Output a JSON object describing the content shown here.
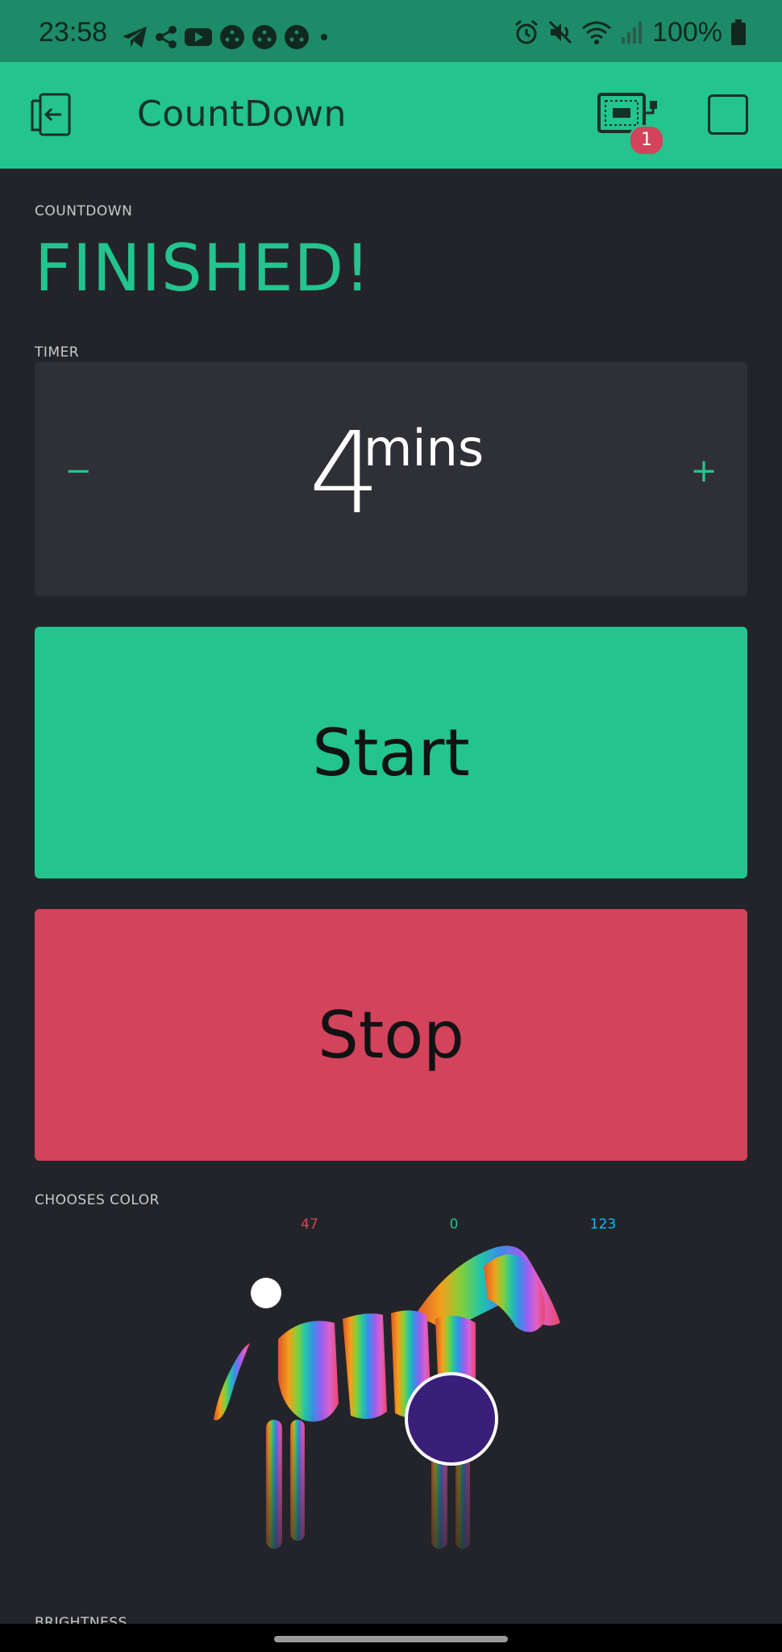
{
  "status": {
    "time": "23:58",
    "battery": "100%"
  },
  "app": {
    "title": "CountDown",
    "device_badge": "1"
  },
  "countdown": {
    "label": "COUNTDOWN",
    "value": "FINISHED!"
  },
  "timer": {
    "label": "TIMER",
    "value": "4",
    "unit": "mins",
    "minus": "−",
    "plus": "+"
  },
  "buttons": {
    "start": "Start",
    "stop": "Stop"
  },
  "color": {
    "label": "CHOOSES COLOR",
    "r": "47",
    "g": "0",
    "b": "123",
    "r_color": "#d3435c",
    "g_color": "#23c48e",
    "b_color": "#04c0f8"
  },
  "brightness": {
    "label": "BRIGHTNESS"
  }
}
